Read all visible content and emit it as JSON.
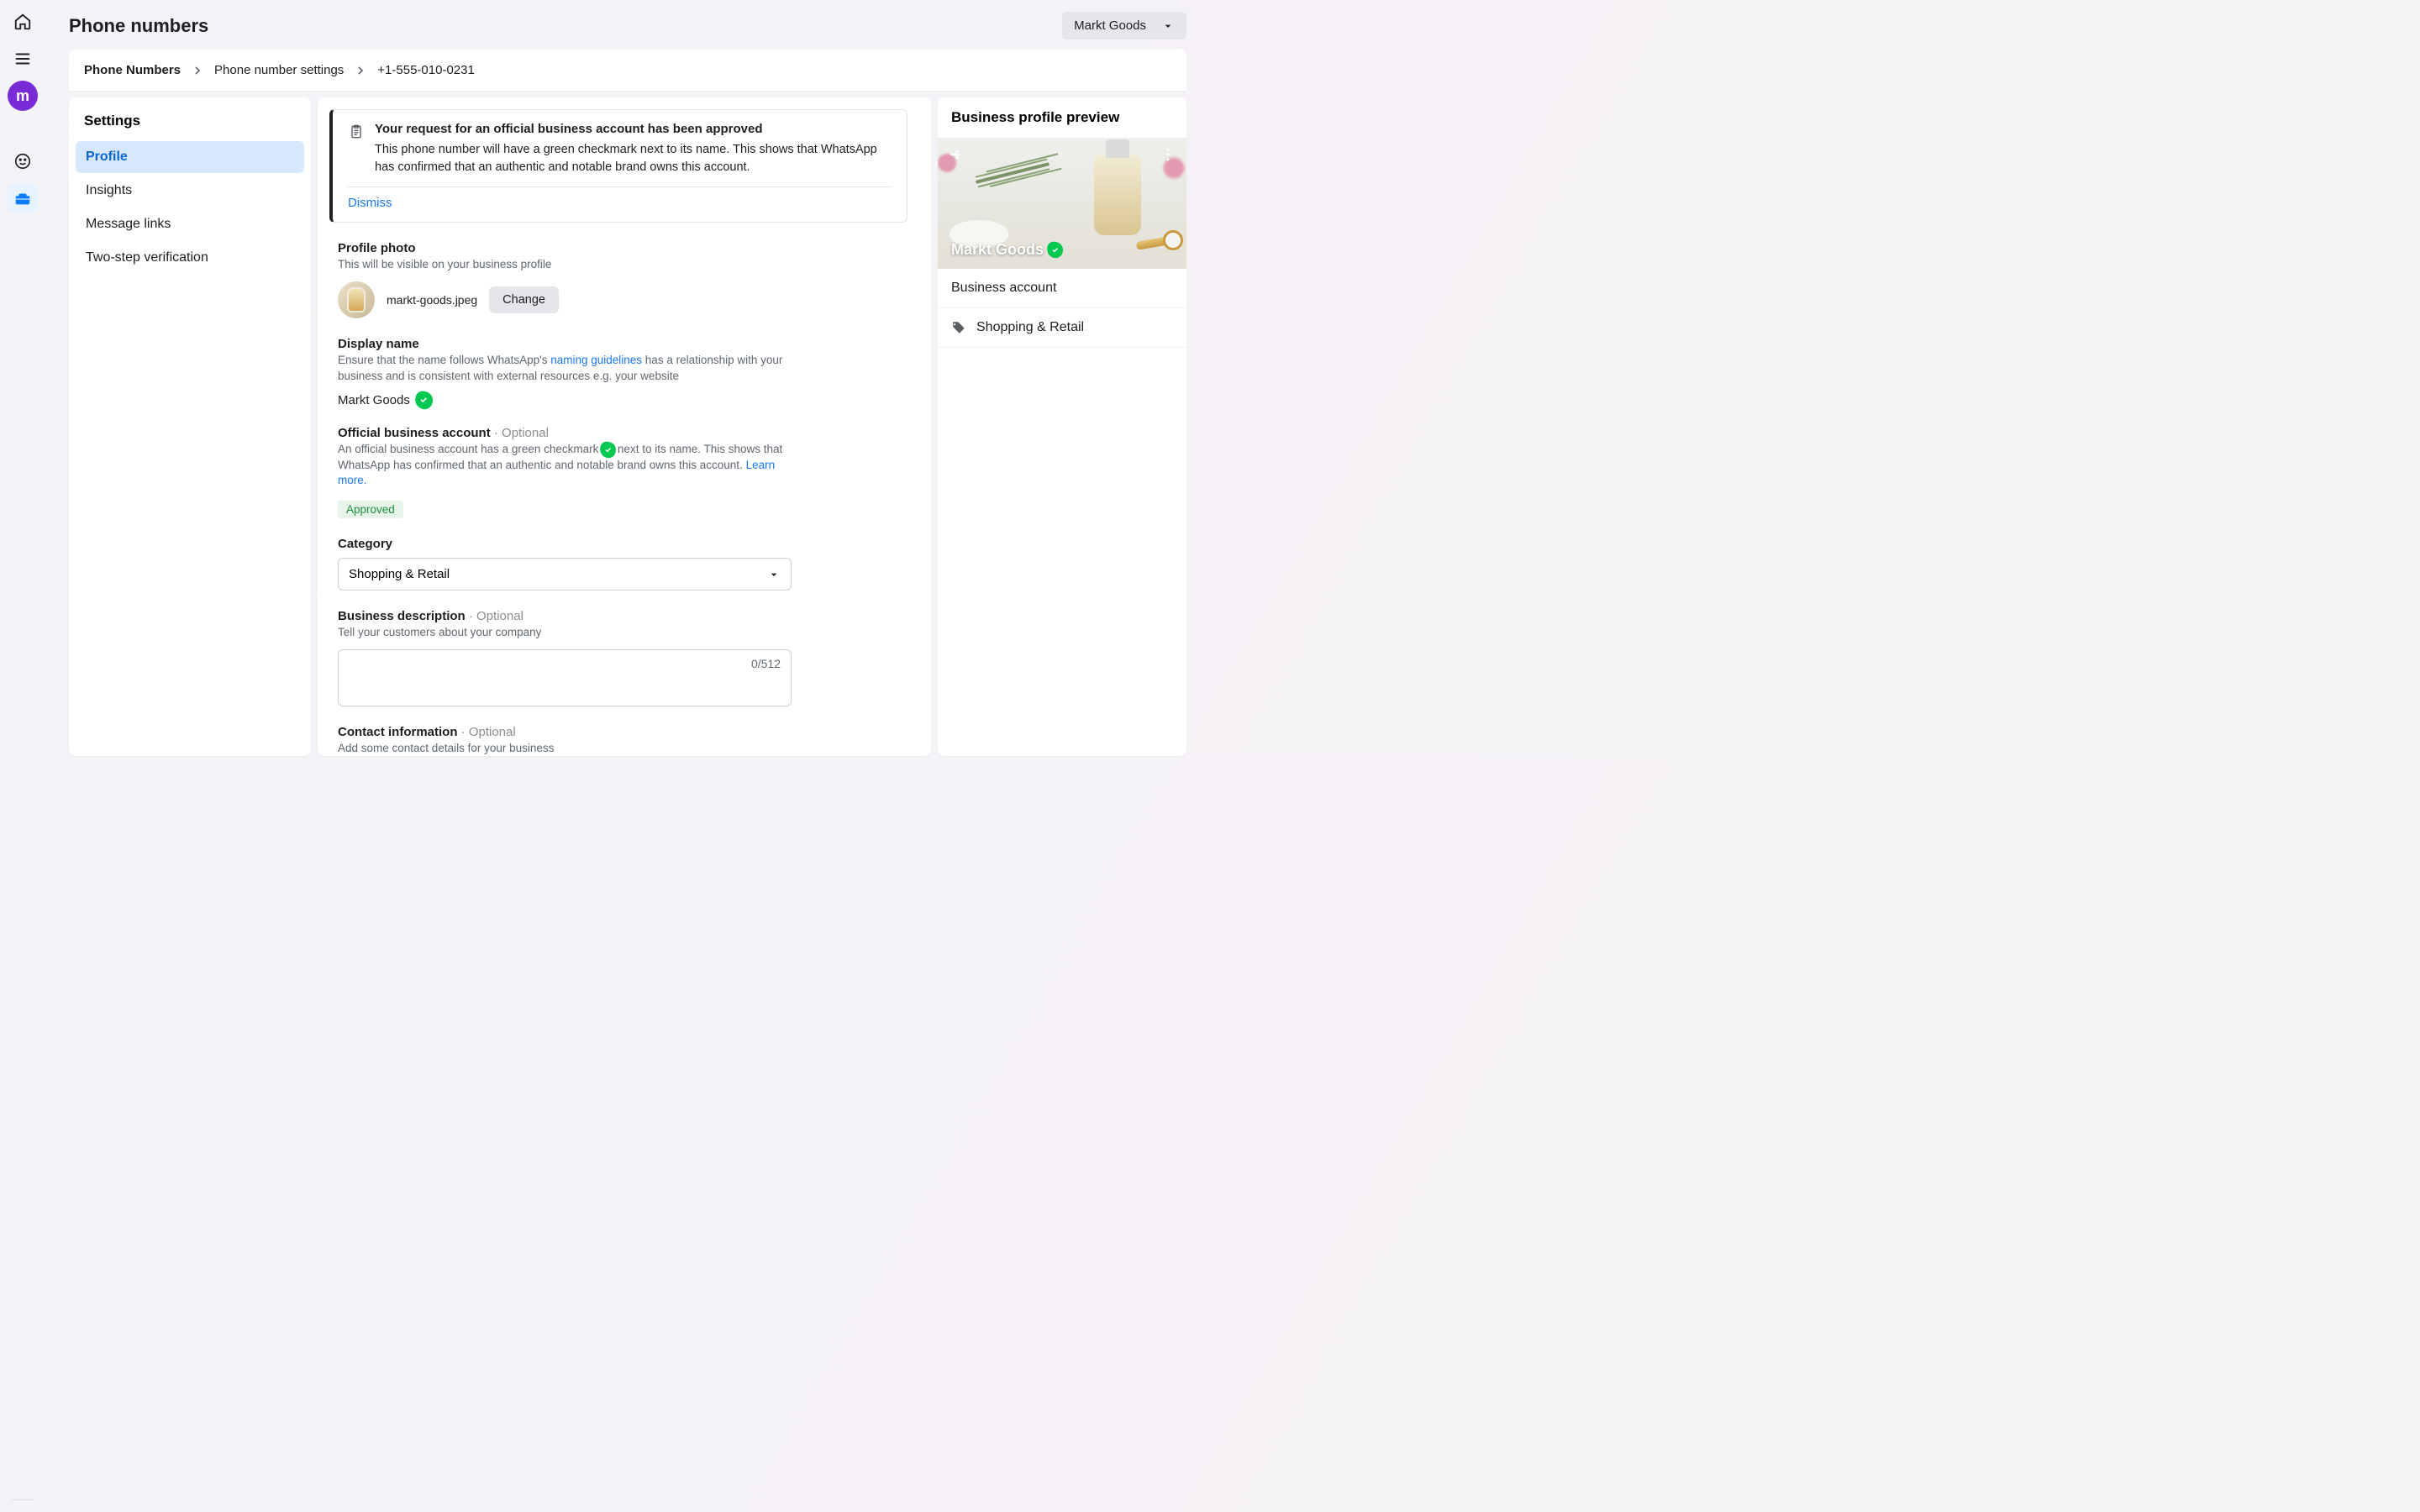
{
  "header": {
    "title": "Phone numbers",
    "account_selector": "Markt Goods"
  },
  "breadcrumb": {
    "root": "Phone Numbers",
    "mid": "Phone number settings",
    "leaf": "+1-555-010-0231"
  },
  "settings": {
    "title": "Settings",
    "items": [
      "Profile",
      "Insights",
      "Message links",
      "Two-step verification"
    ]
  },
  "notice": {
    "title": "Your request for an official business account has been approved",
    "body": "This phone number will have a green checkmark next to its name. This shows that WhatsApp has confirmed that an authentic and notable brand owns this account.",
    "dismiss": "Dismiss"
  },
  "profile_photo": {
    "label": "Profile photo",
    "help": "This will be visible on your business profile",
    "filename": "markt-goods.jpeg",
    "change_btn": "Change"
  },
  "display_name": {
    "label": "Display name",
    "help_prefix": "Ensure that the name follows WhatsApp's ",
    "help_link": "naming guidelines",
    "help_suffix": " has a relationship with your business and is consistent with external resources e.g. your website",
    "value": "Markt Goods"
  },
  "official_account": {
    "label": "Official business account",
    "optional": " · Optional",
    "help_prefix": "An official business account has a green checkmark ",
    "help_mid": " next to its name. This shows that WhatsApp has confirmed that an authentic and notable brand owns this account. ",
    "help_link": "Learn more.",
    "status": "Approved"
  },
  "category": {
    "label": "Category",
    "value": "Shopping & Retail"
  },
  "description": {
    "label": "Business description",
    "optional": " · Optional",
    "help": "Tell your customers about your company",
    "counter": "0/512"
  },
  "contact": {
    "label": "Contact information",
    "optional": " · Optional",
    "help": "Add some contact details for your business"
  },
  "preview": {
    "title": "Business profile preview",
    "business_name": "Markt Goods",
    "account_type": "Business account",
    "category": "Shopping & Retail"
  }
}
